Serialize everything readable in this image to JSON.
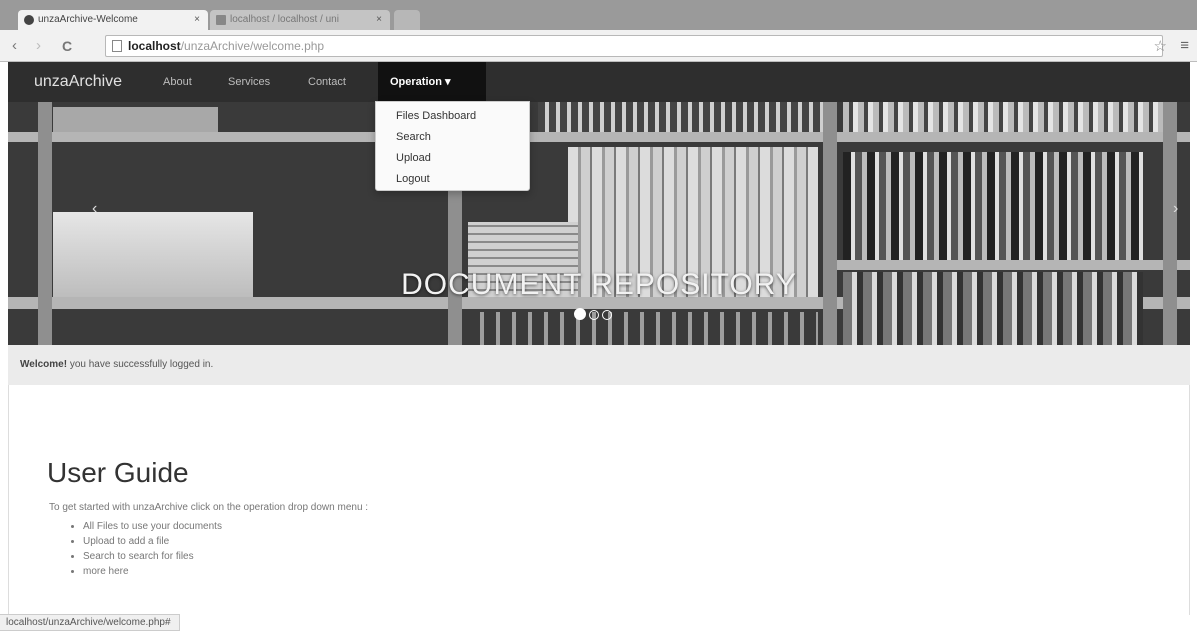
{
  "browser": {
    "tabs": [
      {
        "title": "unzaArchive-Welcome",
        "close": "×"
      },
      {
        "title": "localhost / localhost / uni",
        "close": "×"
      }
    ],
    "nav": {
      "back": "‹",
      "forward": "›",
      "reload": "C"
    },
    "url": {
      "host": "localhost",
      "path": "/unzaArchive/welcome.php"
    },
    "star": "☆",
    "menu": "≡"
  },
  "navbar": {
    "brand": "unzaArchive",
    "links": [
      "About",
      "Services",
      "Contact"
    ],
    "operation": "Operation ▾"
  },
  "dropdown": {
    "items": [
      "Files Dashboard",
      "Search",
      "Upload",
      "Logout"
    ]
  },
  "carousel": {
    "caption": "DOCUMENT REPOSITORY",
    "prev": "‹",
    "next": "›",
    "slide_count": 3,
    "active_slide": 1
  },
  "welcome": {
    "bold": "Welcome!",
    "text": " you have successfully logged in."
  },
  "guide": {
    "title": "User Guide",
    "intro": "To get started with unzaArchive click on the operation drop down menu :",
    "items": [
      "All Files to use your documents",
      "Upload to add a file",
      "Search to search for files",
      "more here"
    ]
  },
  "status": "localhost/unzaArchive/welcome.php#",
  "colors": {
    "navbar": "#2e2e2e",
    "active_nav": "#111111",
    "welcome_bg": "#ebebeb"
  }
}
